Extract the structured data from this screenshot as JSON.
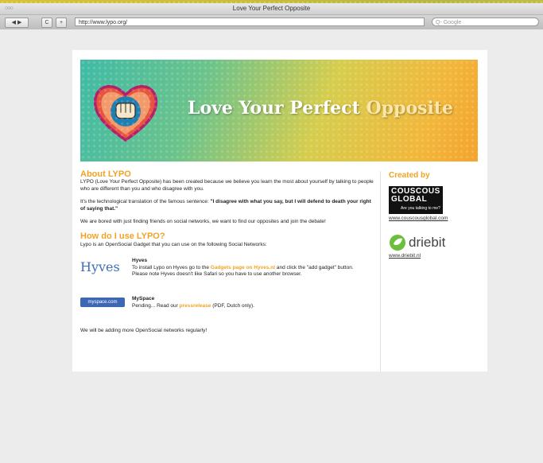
{
  "window": {
    "title": "Love Your Perfect Opposite",
    "traffic": "○○○"
  },
  "toolbar": {
    "back": "◀ ▶",
    "reload": "C",
    "add": "+",
    "url": "http://www.lypo.org/",
    "search_placeholder": "Q- Google"
  },
  "banner": {
    "title_main": "Love Your Perfect ",
    "title_accent": "Opposite"
  },
  "about": {
    "heading": "About LYPO",
    "p1": "LYPO (Love Your Perfect Opposite) has been created because we believe you learn the most about yourself by talking to people who are different than you and who disagree with you.",
    "p2_pre": "It's the technological translation of the famous sentence: ",
    "p2_quote": "\"I disagree with what you say, but I will defend to death your right of saying that.\"",
    "p3": "We are bored with just finding friends on social networks, we want to find our opposites and join the debate!"
  },
  "howto": {
    "heading": "How do I use LYPO?",
    "intro": "Lypo is an OpenSocial Gadget that you can use on the following Social Networks:",
    "hyves": {
      "logo": "Hyves",
      "name": "Hyves",
      "text_pre": "To install Lypo on Hyves go to the ",
      "link": "Gadgets page on Hyves.nl",
      "text_post": " and click the \"add gadget\" button. Please note Hyves doesn't like Safari so you have to use another browser."
    },
    "myspace": {
      "logo": "myspace.com",
      "name": "MySpace",
      "text_pre": "Pending... Read our ",
      "link": "pressrelease",
      "text_post": " (PDF, Dutch only)."
    },
    "footer": "We will be adding more OpenSocial networks regularly!"
  },
  "sidebar": {
    "heading": "Created by",
    "cc_line1": "COUSCOUS",
    "cc_line2": "GLOBAL",
    "cc_tag": "Are you talking to me?",
    "cc_url": "www.couscousglobal.com",
    "db_name": "driebit",
    "db_url": "www.driebit.nl"
  },
  "colors": {
    "accent": "#f0a326",
    "hyves": "#3b6fb6",
    "myspace": "#3c67b4"
  }
}
